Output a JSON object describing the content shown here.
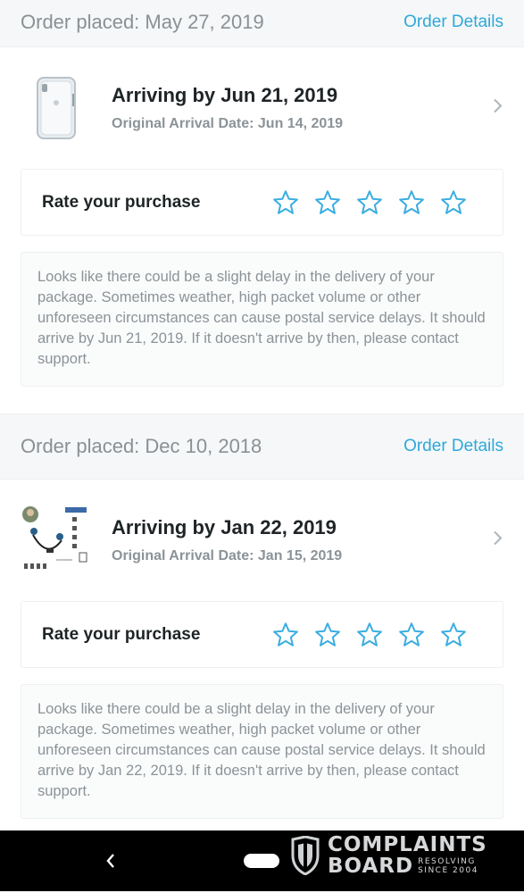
{
  "orders": [
    {
      "placed": "Order placed: May 27, 2019",
      "details_link": "Order Details",
      "arriving": "Arriving by Jun 21, 2019",
      "original": "Original Arrival Date: Jun 14, 2019",
      "rate_label": "Rate your purchase",
      "notice": "Looks like there could be a slight delay in the delivery of your package. Sometimes weather, high packet volume or other unforeseen circumstances can cause postal service delays. It should arrive by Jun 21, 2019. If it doesn't arrive by then, please contact support."
    },
    {
      "placed": "Order placed: Dec 10, 2018",
      "details_link": "Order Details",
      "arriving": "Arriving by Jan 22, 2019",
      "original": "Original Arrival Date: Jan 15, 2019",
      "rate_label": "Rate your purchase",
      "notice": "Looks like there could be a slight delay in the delivery of your package. Sometimes weather, high packet volume or other unforeseen circumstances can cause postal service delays. It should arrive by Jan 22, 2019. If it doesn't arrive by then, please contact support."
    }
  ],
  "watermark": {
    "line1": "COMPLAINTS",
    "line2": "BOARD",
    "tag1": "RESOLVING",
    "tag2": "SINCE 2004"
  },
  "colors": {
    "accent": "#2ea8d9",
    "star": "#3aaee0",
    "header_bg": "#f5f7f8"
  },
  "icons": {
    "star": "star-outline",
    "chevron": "chevron-right",
    "back": "back-arrow"
  }
}
